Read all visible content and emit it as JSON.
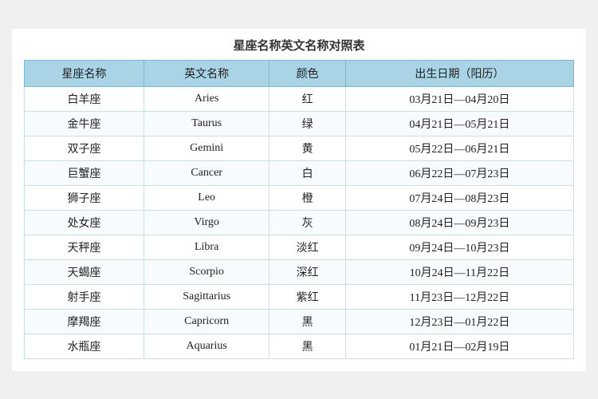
{
  "title": "星座名称英文名称对照表",
  "columns": [
    "星座名称",
    "英文名称",
    "颜色",
    "出生日期（阳历）"
  ],
  "rows": [
    {
      "chinese": "白羊座",
      "english": "Aries",
      "color": "红",
      "dates": "03月21日—04月20日"
    },
    {
      "chinese": "金牛座",
      "english": "Taurus",
      "color": "绿",
      "dates": "04月21日—05月21日"
    },
    {
      "chinese": "双子座",
      "english": "Gemini",
      "color": "黄",
      "dates": "05月22日—06月21日"
    },
    {
      "chinese": "巨蟹座",
      "english": "Cancer",
      "color": "白",
      "dates": "06月22日—07月23日"
    },
    {
      "chinese": "狮子座",
      "english": "Leo",
      "color": "橙",
      "dates": "07月24日—08月23日"
    },
    {
      "chinese": "处女座",
      "english": "Virgo",
      "color": "灰",
      "dates": "08月24日—09月23日"
    },
    {
      "chinese": "天秤座",
      "english": "Libra",
      "color": "淡红",
      "dates": "09月24日—10月23日"
    },
    {
      "chinese": "天蝎座",
      "english": "Scorpio",
      "color": "深红",
      "dates": "10月24日—11月22日"
    },
    {
      "chinese": "射手座",
      "english": "Sagittarius",
      "color": "紫红",
      "dates": "11月23日—12月22日"
    },
    {
      "chinese": "摩羯座",
      "english": "Capricorn",
      "color": "黑",
      "dates": "12月23日—01月22日"
    },
    {
      "chinese": "水瓶座",
      "english": "Aquarius",
      "color": "黑",
      "dates": "01月21日—02月19日"
    }
  ]
}
